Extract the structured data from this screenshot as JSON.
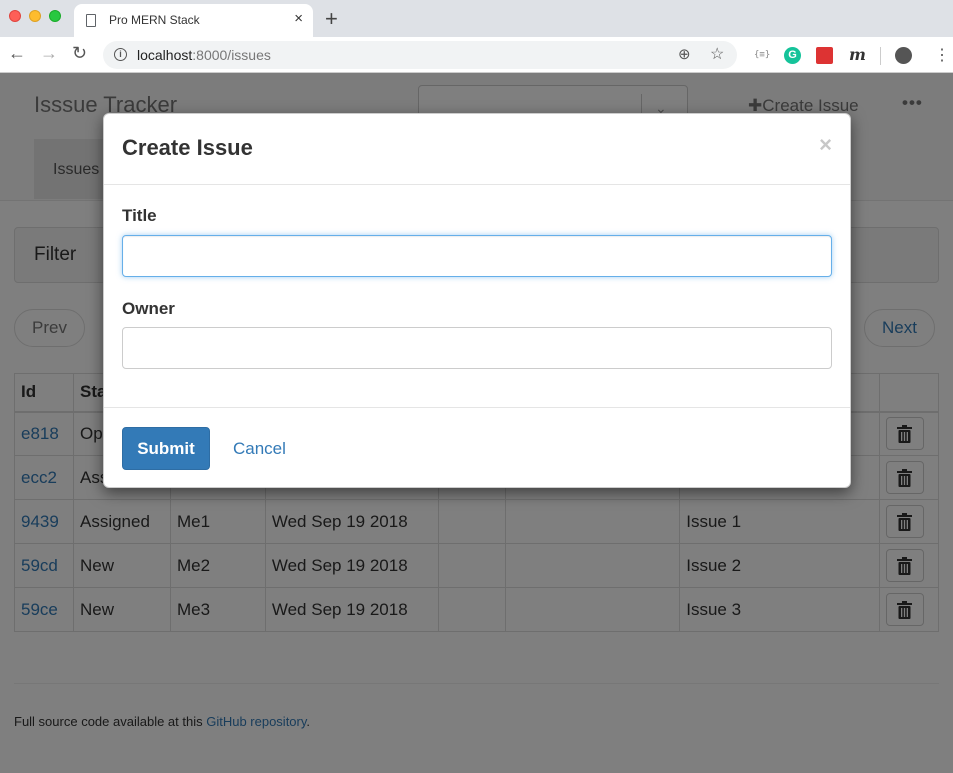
{
  "browser": {
    "tab_title": "Pro MERN Stack",
    "tab_close": "×",
    "new_tab": "+",
    "url_host": "localhost",
    "url_rest": ":8000/issues",
    "back": "←",
    "forward": "→",
    "reload": "↻",
    "zoom_icon": "⊕",
    "star_icon": "☆",
    "ext_code": "{≡}",
    "ext_g": "G",
    "ext_m": "m",
    "menu": "⋮"
  },
  "navbar": {
    "brand": "Isssue Tracker",
    "create_issue": "Create Issue",
    "create_icon": "✚",
    "more": "•••",
    "active_tab": "Issues",
    "select_arrow": "⌄"
  },
  "filter": {
    "label": "Filter"
  },
  "pager": {
    "prev": "Prev",
    "next": "Next"
  },
  "table": {
    "headers": [
      "Id",
      "Sta"
    ],
    "rows": [
      {
        "id": "e818",
        "status": "Op",
        "owner": "",
        "created": "",
        "title": ""
      },
      {
        "id": "ecc2",
        "status": "Ass",
        "owner": "",
        "created": "",
        "title": ""
      },
      {
        "id": "9439",
        "status": "Assigned",
        "owner": "Me1",
        "created": "Wed Sep 19 2018",
        "title": "Issue 1"
      },
      {
        "id": "59cd",
        "status": "New",
        "owner": "Me2",
        "created": "Wed Sep 19 2018",
        "title": "Issue 2"
      },
      {
        "id": "59ce",
        "status": "New",
        "owner": "Me3",
        "created": "Wed Sep 19 2018",
        "title": "Issue 3"
      }
    ]
  },
  "footer": {
    "text": "Full source code available at this ",
    "link": "GitHub repository",
    "end": "."
  },
  "modal": {
    "title": "Create Issue",
    "close": "×",
    "title_label": "Title",
    "title_value": "",
    "owner_label": "Owner",
    "owner_value": "",
    "submit": "Submit",
    "cancel": "Cancel"
  },
  "colors": {
    "primary": "#337ab7",
    "focus_border": "#66afe9"
  }
}
